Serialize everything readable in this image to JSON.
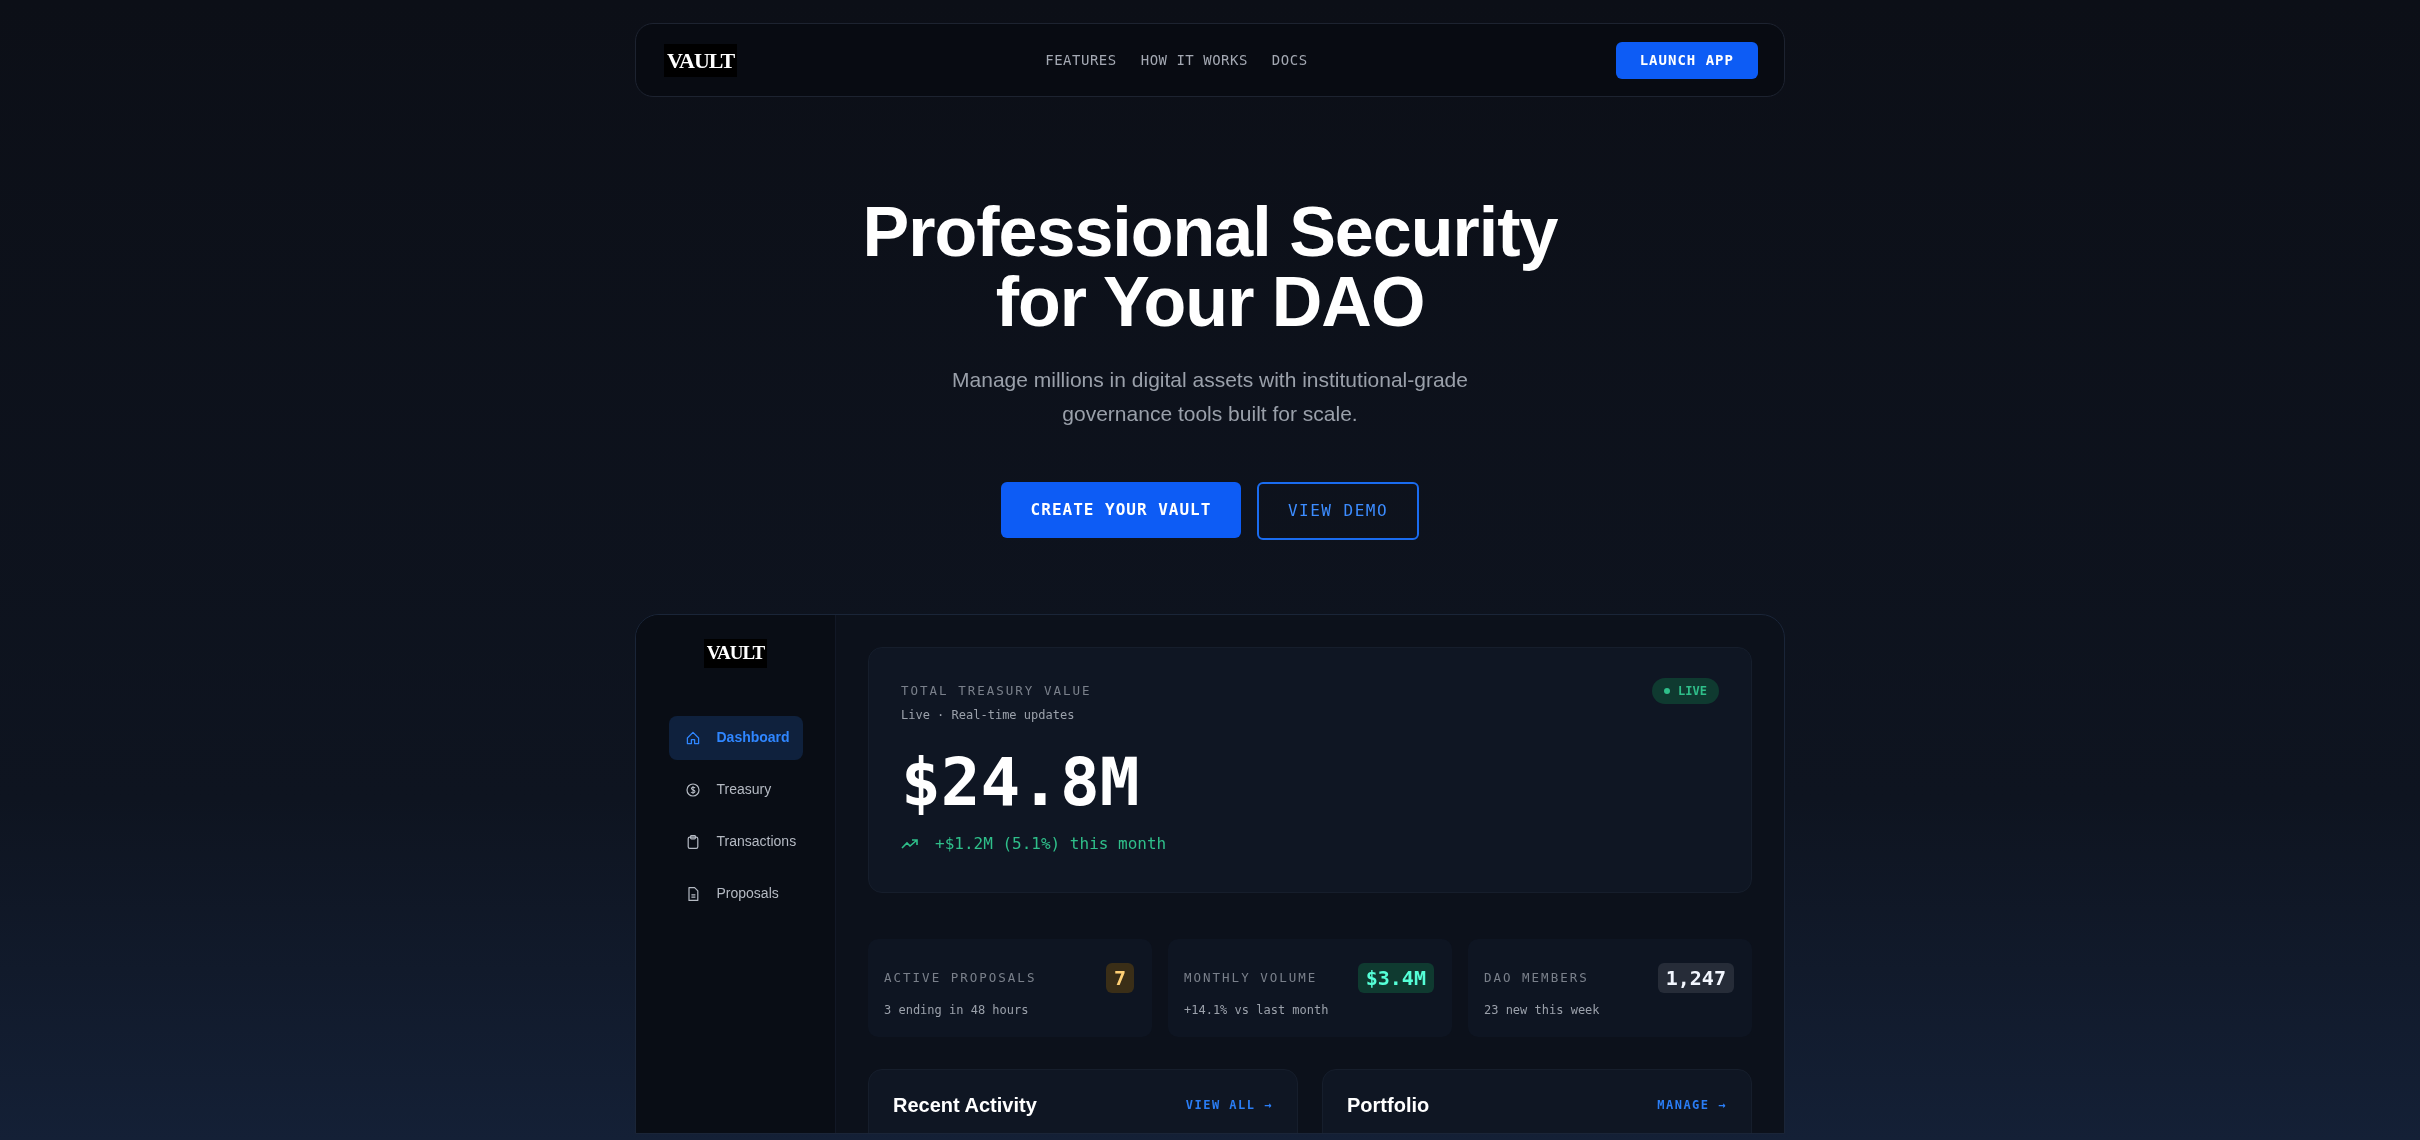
{
  "navbar": {
    "logo": "VAULT",
    "links": [
      "FEATURES",
      "HOW IT WORKS",
      "DOCS"
    ],
    "cta": "LAUNCH APP"
  },
  "hero": {
    "title_lines": [
      "Professional Security",
      "for Your DAO"
    ],
    "subtitle": "Manage millions in digital assets with institutional-grade governance tools built for scale.",
    "primary_button": "CREATE YOUR VAULT",
    "secondary_button": "VIEW DEMO"
  },
  "dashboard": {
    "logo": "VAULT",
    "sidebar": {
      "items": [
        {
          "label": "Dashboard",
          "selected": true
        },
        {
          "label": "Treasury",
          "selected": false
        },
        {
          "label": "Transactions",
          "selected": false
        },
        {
          "label": "Proposals",
          "selected": false
        }
      ]
    },
    "treasury": {
      "label": "TOTAL TREASURY VALUE",
      "sublabel": "Live · Real-time updates",
      "status": "LIVE",
      "value": "$24.8M",
      "change": "+$1.2M (5.1%) this month"
    },
    "stats": [
      {
        "label": "ACTIVE PROPOSALS",
        "value": "7",
        "note": "3 ending in 48 hours",
        "color": "#3a2e17"
      },
      {
        "label": "MONTHLY VOLUME",
        "value": "$3.4M",
        "note": "+14.1% vs last month",
        "color": "#0f3a30"
      },
      {
        "label": "DAO MEMBERS",
        "value": "1,247",
        "note": "23 new this week",
        "color": "#262c38"
      }
    ],
    "panels": [
      {
        "title": "Recent Activity",
        "link": "VIEW ALL →"
      },
      {
        "title": "Portfolio",
        "link": "MANAGE →"
      }
    ]
  }
}
